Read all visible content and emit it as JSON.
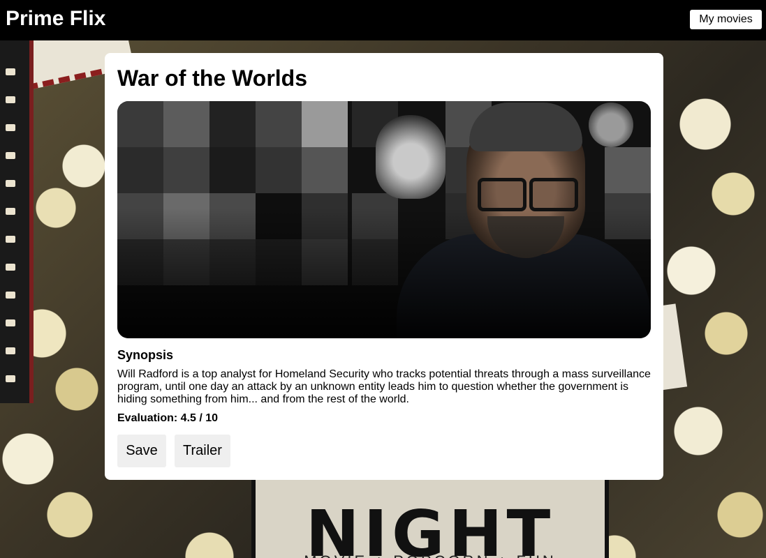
{
  "header": {
    "brand": "Prime Flix",
    "my_movies_label": "My movies"
  },
  "movie": {
    "title": "War of the Worlds",
    "synopsis_heading": "Synopsis",
    "synopsis": "Will Radford is a top analyst for Homeland Security who tracks potential threats through a mass surveillance program, until one day an attack by an unknown entity leads him to question whether the government is hiding something from him... and from the rest of the world.",
    "evaluation_text": "Evaluation: 4.5 / 10"
  },
  "actions": {
    "save_label": "Save",
    "trailer_label": "Trailer"
  },
  "background": {
    "sign_word": "NIGHT",
    "sign_sub": "MOVIE + POPCORN + FUN"
  }
}
